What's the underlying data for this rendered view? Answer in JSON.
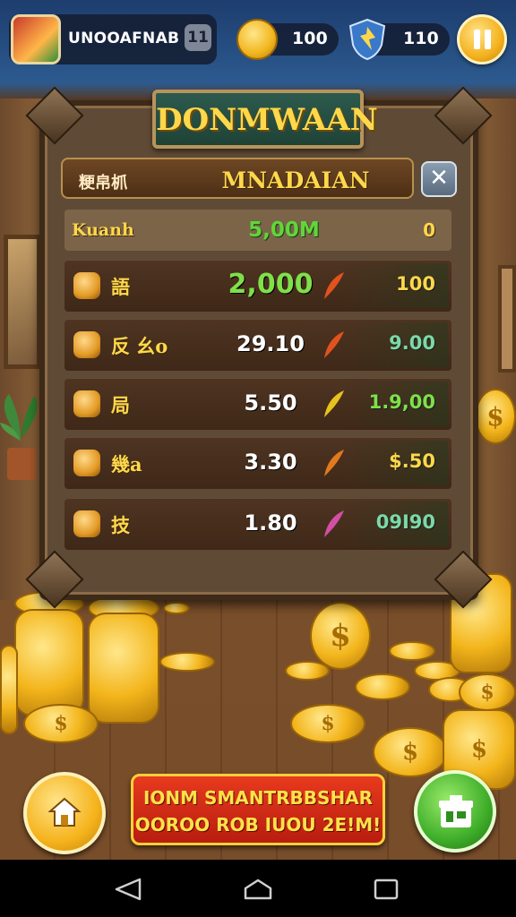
{
  "hud": {
    "player_name": "UNOOAFNAB",
    "level": "11",
    "gold_amount": "100",
    "gem_amount": "110"
  },
  "board": {
    "title": "DONMWAAN",
    "header_label": "粳帛枛",
    "header_title": "MNADAIAN",
    "close_label": "✕",
    "summary": {
      "label": "Kuanh",
      "value": "5,00M",
      "extra": "0"
    },
    "items": [
      {
        "name": "語",
        "price": "2,000",
        "change": "100",
        "trend_color": "#e2521d",
        "change_color": "#ffd84a",
        "icon": "gold-bar-icon"
      },
      {
        "name": "反 幺о",
        "price": "29.10",
        "change": "9.00",
        "trend_color": "#e2521d",
        "change_color": "#7bd9a8",
        "icon": "quill-icon"
      },
      {
        "name": "局",
        "price": "5.50",
        "change": "1.9,00",
        "trend_color": "#e8c21d",
        "change_color": "#7fe04a",
        "icon": "ring-icon"
      },
      {
        "name": "幾a",
        "price": "3.30",
        "change": "$.50",
        "trend_color": "#e07a1d",
        "change_color": "#ffd84a",
        "icon": "pouch-icon"
      },
      {
        "name": "技",
        "price": "1.80",
        "change": "09I90",
        "trend_color": "#d24fa4",
        "change_color": "#7bd9a8",
        "icon": "flower-icon"
      }
    ]
  },
  "banner": {
    "line1": "IONM SMANTRBBSHAR",
    "line2": "OOROO ROB IUOU 2E!M!"
  },
  "colors": {
    "accent_gold": "#ffd84a",
    "positive_green": "#5fd63a",
    "banner_red": "#e83a1e"
  }
}
